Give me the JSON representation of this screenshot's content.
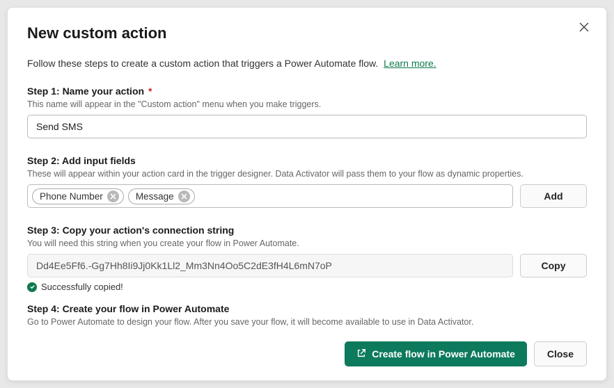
{
  "title": "New custom action",
  "intro_text": "Follow these steps to create a custom action that triggers a Power Automate flow.",
  "learn_more": "Learn more.",
  "step1": {
    "title": "Step 1: Name your action",
    "required_mark": "*",
    "desc": "This name will appear in the \"Custom action\" menu when you make triggers.",
    "value": "Send SMS"
  },
  "step2": {
    "title": "Step 2: Add input fields",
    "desc": "These will appear within your action card in the trigger designer. Data Activator will pass them to your flow as dynamic properties.",
    "tags": [
      "Phone Number",
      "Message"
    ],
    "add_label": "Add"
  },
  "step3": {
    "title": "Step 3: Copy your action's connection string",
    "desc": "You will need this string when you create your flow in Power Automate.",
    "value": "Dd4Ee5Ff6.-Gg7Hh8Ii9Jj0Kk1Ll2_Mm3Nn4Oo5C2dE3fH4L6mN7oP",
    "copy_label": "Copy",
    "success_msg": "Successfully copied!"
  },
  "step4": {
    "title": "Step 4: Create your flow in Power Automate",
    "desc": "Go to Power Automate to design your flow. After you save your flow, it will become available to use in Data Activator."
  },
  "footer": {
    "create_label": "Create flow in Power Automate",
    "close_label": "Close"
  }
}
